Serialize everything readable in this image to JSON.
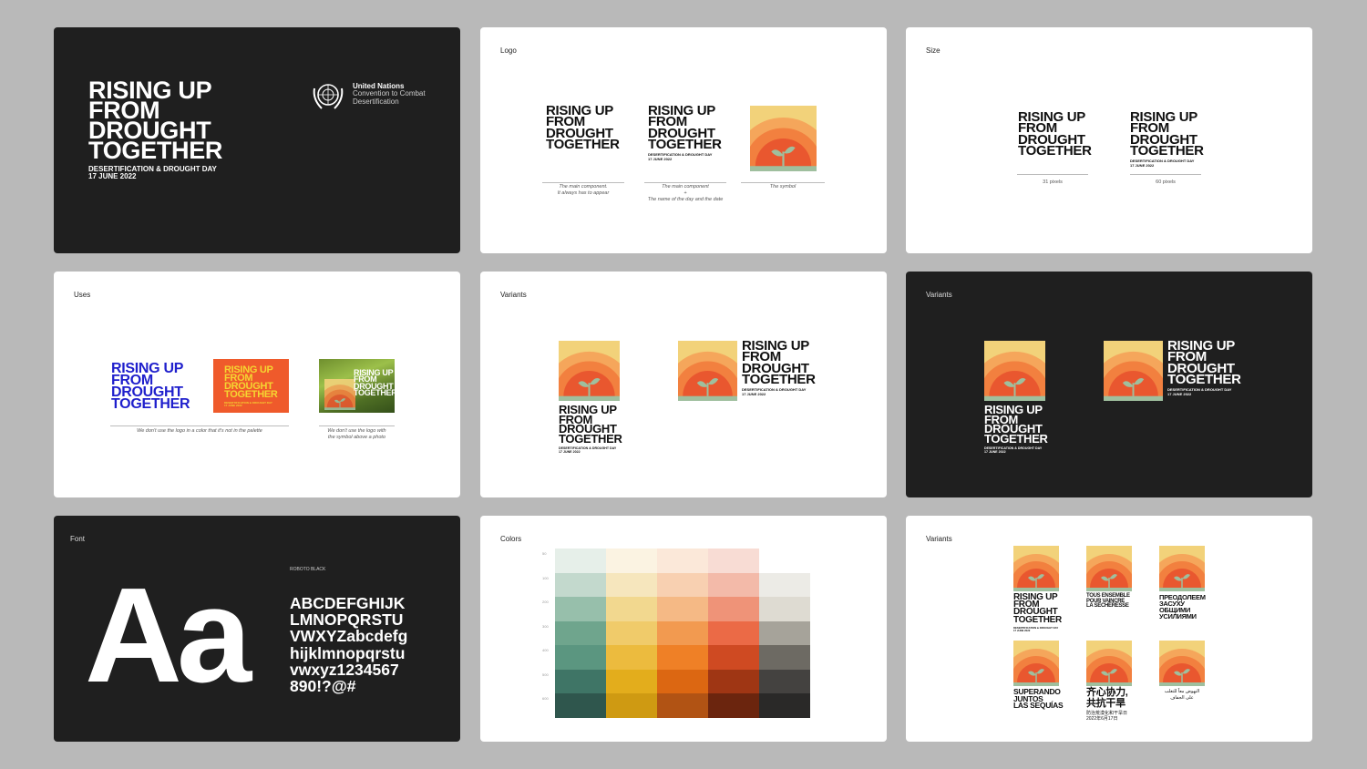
{
  "logo_lines": [
    "RISING UP",
    "FROM",
    "DROUGHT",
    "TOGETHER"
  ],
  "logo_sub1": "DESERTIFICATION & DROUGHT DAY",
  "logo_sub2": "17 JUNE 2022",
  "un": {
    "name": "United Nations",
    "line2": "Convention to Combat",
    "line3": "Desertification"
  },
  "cards": {
    "logo": {
      "title": "Logo",
      "cap1": "The main component.\nIt always has to appear",
      "cap2a": "The main component",
      "cap2b": "+",
      "cap2c": "The name of the day and the date",
      "cap3": "The symbol"
    },
    "size": {
      "title": "Size",
      "cap1": "31 pixels",
      "cap2": "60 pixels"
    },
    "uses": {
      "title": "Uses",
      "cap1": "We don't use the logo in a color that it's not in the palette",
      "cap2": "We don't use the logo with\nthe symbol above a photo"
    },
    "variants_white": {
      "title": "Variants"
    },
    "variants_dark": {
      "title": "Variants"
    },
    "font": {
      "title": "Font",
      "font_name": "ROBOTO BLACK",
      "sample": "Aa",
      "alphabet": [
        "ABCDEFGHIJK",
        "LMNOPQRSTU",
        "VWXYZabcdefg",
        "hijklmnopqrstu",
        "vwxyz1234567",
        "890!?@#"
      ]
    },
    "colors": {
      "title": "Colors",
      "row_labels": [
        "50",
        "100",
        "200",
        "300",
        "400",
        "500",
        "600"
      ]
    },
    "variants_lang": {
      "title": "Variants",
      "fr": [
        "TOUS ENSEMBLE",
        "POUR VAINCRE",
        "LA SÉCHERESSE"
      ],
      "ru": [
        "ПРЕОДОЛЕЕМ",
        "ЗАСУХУ",
        "ОБЩИМИ",
        "УСИЛИЯМИ"
      ],
      "es": [
        "SUPERANDO",
        "JUNTOS",
        "LAS SEQUÍAS"
      ],
      "zh": [
        "齐心协力,",
        "共抗干旱"
      ],
      "zh_sub": [
        "防治荒漠化和干旱日",
        "2022年6月17日"
      ],
      "ar": [
        "النهوض معاً للتغلب",
        "على الجفاف"
      ]
    }
  },
  "palette": [
    [
      "#e6efe9",
      "#c3d9cd",
      "#97bfab",
      "#6fa58d",
      "#5b9680",
      "#3f7566",
      "#2f564d"
    ],
    [
      "#fbf3e2",
      "#f6e6bd",
      "#f2d88f",
      "#f0cb6a",
      "#ecbb3e",
      "#e3ad1c",
      "#cf9a12"
    ],
    [
      "#fbe8d9",
      "#f8d0b1",
      "#f5b985",
      "#f29a50",
      "#ef8026",
      "#dc6712",
      "#b15314"
    ],
    [
      "#f8dcd4",
      "#f3baa9",
      "#ef9378",
      "#eb6a46",
      "#cf4a22",
      "#9f3614",
      "#6b250e"
    ],
    [
      "#f5f3ef",
      "#ecebe6",
      "#dedbd2",
      "#a6a39a",
      "#6d6a63",
      "#444240",
      "#2a2928"
    ]
  ],
  "colors": {
    "sun1": "#f2d27a",
    "sun2": "#f5a65b",
    "sun3": "#f2803f",
    "sun4": "#e9572f",
    "ground": "#9fbf9e",
    "uses_blue": "#1f1fcc",
    "uses_orange": "#ef5a2b",
    "uses_yellow": "#f5d531"
  }
}
